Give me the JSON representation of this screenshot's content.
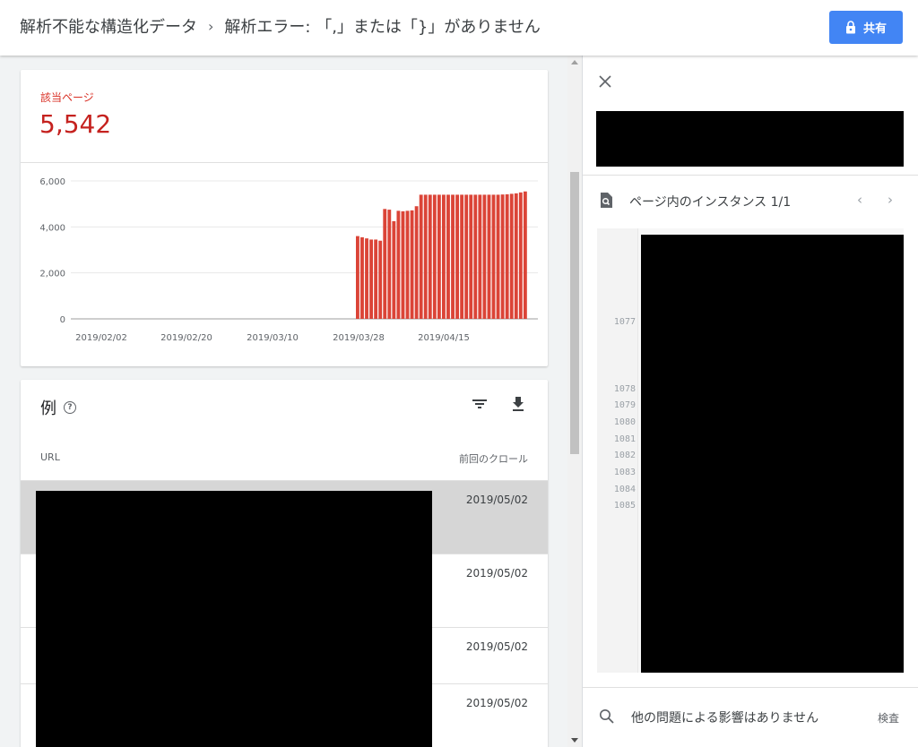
{
  "header": {
    "breadcrumb_root": "解析不能な構造化データ",
    "breadcrumb_sep": "›",
    "breadcrumb_current": "解析エラー: 「,」または「}」がありません",
    "share_label": "共有"
  },
  "summary": {
    "label": "該当ページ",
    "value": "5,542"
  },
  "chart_data": {
    "type": "bar",
    "color": "#db4437",
    "ylim": [
      0,
      6000
    ],
    "y_ticks": [
      "0",
      "2,000",
      "4,000",
      "6,000"
    ],
    "x_tick_labels": [
      "2019/02/02",
      "2019/02/20",
      "2019/03/10",
      "2019/03/28",
      "2019/04/15"
    ],
    "values": [
      3600,
      3550,
      3500,
      3450,
      3450,
      3400,
      4780,
      4750,
      4250,
      4700,
      4680,
      4700,
      4720,
      4900,
      5400,
      5400,
      5400,
      5400,
      5400,
      5400,
      5400,
      5400,
      5400,
      5400,
      5400,
      5400,
      5400,
      5400,
      5400,
      5400,
      5400,
      5400,
      5410,
      5420,
      5440,
      5460,
      5500,
      5542
    ]
  },
  "examples": {
    "title": "例",
    "help_icon": "?",
    "col_url": "URL",
    "col_last_crawl": "前回のクロール",
    "rows": [
      {
        "date": "2019/05/02"
      },
      {
        "date": "2019/05/02"
      },
      {
        "date": "2019/05/02"
      },
      {
        "date": "2019/05/02"
      }
    ]
  },
  "detail": {
    "instances_label": "ページ内のインスタンス 1/1",
    "nav_prev": "‹",
    "nav_next": "›",
    "line_numbers": [
      "1077",
      "1078",
      "1079",
      "1080",
      "1081",
      "1082",
      "1083",
      "1084",
      "1085"
    ],
    "no_issues_text": "他の問題による影響はありません",
    "inspect_label": "検査"
  },
  "colors": {
    "accent": "#4285f4",
    "error": "#d93025",
    "bar": "#db4437"
  }
}
